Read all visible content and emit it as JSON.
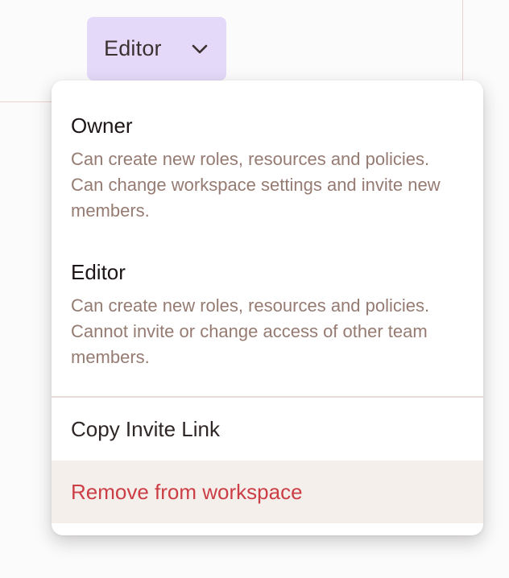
{
  "role_select": {
    "selected": "Editor",
    "chevron_icon": "chevron-down-icon"
  },
  "menu": {
    "options": [
      {
        "title": "Owner",
        "description": "Can create new roles, resources and policies. Can change workspace settings and invite new members."
      },
      {
        "title": "Editor",
        "description": "Can create new roles, resources and policies. Cannot invite or change access of other team members."
      }
    ],
    "actions": {
      "copy_invite_link": "Copy Invite Link",
      "remove_from_workspace": "Remove from workspace"
    }
  },
  "colors": {
    "trigger_bg": "#e4d9f8",
    "description_text": "#967b72",
    "danger_text": "#cc3e45",
    "hover_row_bg": "#f5efec"
  }
}
